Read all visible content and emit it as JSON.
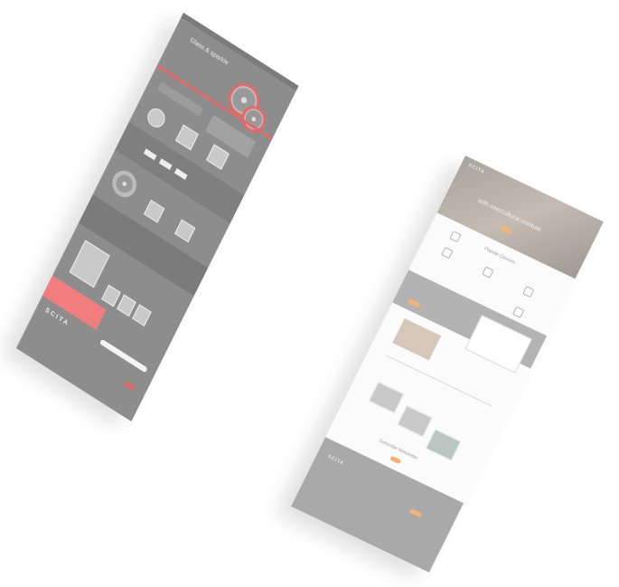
{
  "left_mockup": {
    "hero_title": "Glass & sparkle",
    "footer_logo": "SCITA",
    "accent_color": "#e46a6a",
    "background_color": "#8d8d8d"
  },
  "right_mockup": {
    "logo": "SCITA",
    "hero_title": "with intercultural institute",
    "section_courses": "Popular Courses",
    "section_newsletter": "Subscribe Newsletter",
    "footer_logo": "SCITA",
    "accent_color": "#f5b276",
    "footer_color": "#a9a9a9"
  }
}
